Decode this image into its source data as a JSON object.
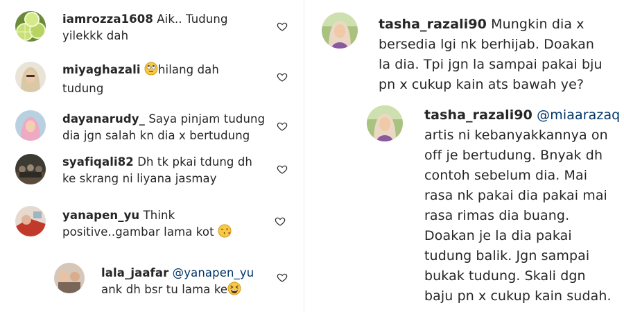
{
  "left_comments": [
    {
      "username": "iamrozza1608",
      "text_line1": " Aik.. Tudung",
      "text_line2": "yilekkk dah",
      "avatar": "lime-slices-avatar"
    },
    {
      "username": "miyaghazali",
      "emoji_before": "rolling-eyes-emoji",
      "text_line1": "hilang dah",
      "text_line2": "tudung",
      "avatar": "hijab-woman-avatar"
    },
    {
      "username": "dayanarudy_",
      "text_line1": " Saya pinjam tudung",
      "text_line2": "dia jgn salah kn dia x bertudung",
      "avatar": "woman-portrait-avatar"
    },
    {
      "username": "syafiqali82",
      "text_line1": " Dh tk pkai tdung dh",
      "text_line2": "ke skrang ni liyana jasmay",
      "avatar": "group-photo-avatar"
    },
    {
      "username": "yanapen_yu",
      "text_line1": " Think",
      "text_line2": "positive..gambar lama kot",
      "emoji_after": "blowing-kiss-emoji",
      "avatar": "red-car-avatar"
    }
  ],
  "left_reply": {
    "username": "lala_jaafar",
    "mention": "@yanapen_yu",
    "text_line2": "ank dh bsr tu lama ke",
    "emoji_after": "laughing-squint-emoji",
    "avatar": "couple-avatar"
  },
  "right_comment": {
    "username": "tasha_razali90",
    "lines": [
      " Mungkin dia x",
      "bersedia lgi nk berhijab. Doakan",
      "la dia. Tpi jgn la sampai pakai bju",
      "pn x cukup kain ats bawah ye?"
    ],
    "avatar": "hijab-woman-garden-avatar"
  },
  "right_reply": {
    "username": "tasha_razali90",
    "mention": "@miaarazaq",
    "lines": [
      "artis ni kebanyakkannya on",
      "off je bertudung. Bnyak dh",
      "contoh sebelum dia. Mai",
      "rasa nk pakai dia pakai mai",
      "rasa rimas dia buang.",
      "Doakan je la dia pakai",
      "tudung balik. Jgn sampai",
      "bukak tudung. Skali dgn",
      "baju pn x cukup kain sudah."
    ],
    "avatar": "hijab-woman-garden-avatar"
  },
  "icons": {
    "heart": "heart-outline-icon"
  },
  "colors": {
    "text": "#262626",
    "mention": "#003569",
    "heart": "#262626"
  }
}
